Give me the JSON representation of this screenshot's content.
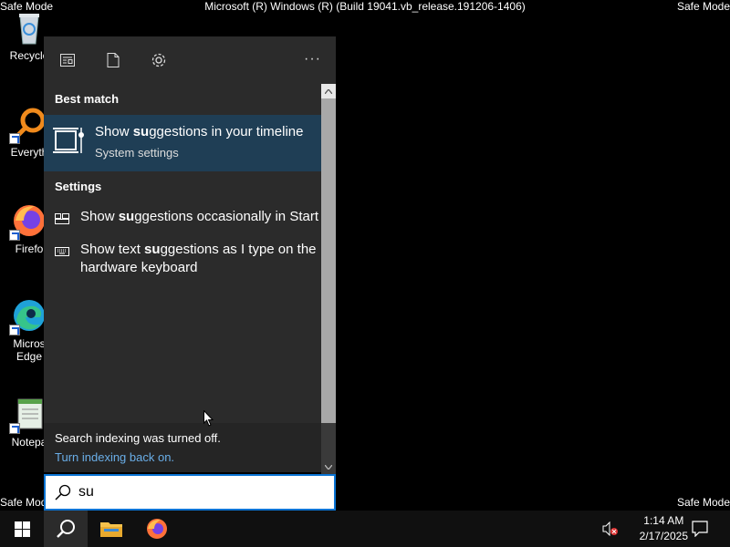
{
  "corners": {
    "top_left": "Safe Mode",
    "top_right": "Safe Mode",
    "bottom_left": "Safe Mode",
    "bottom_right": "Safe Mode",
    "build": "Microsoft (R) Windows (R) (Build 19041.vb_release.191206-1406)"
  },
  "desktop_icons": [
    {
      "label": "Recycle",
      "icon": "recycle-bin-icon"
    },
    {
      "label": "Everyth",
      "icon": "everything-search-icon"
    },
    {
      "label": "Firefo",
      "icon": "firefox-icon"
    },
    {
      "label": "Micros Edge",
      "label_line1": "Micros",
      "label_line2": "Edge",
      "icon": "edge-icon"
    },
    {
      "label": "Notepa",
      "icon": "notepad-icon"
    }
  ],
  "panel": {
    "top_icons": [
      "news-feed-icon",
      "document-icon",
      "gear-icon"
    ],
    "more": "···",
    "best_match_heading": "Best match",
    "best_match": {
      "title_pre": "Show ",
      "title_bold": "su",
      "title_post": "ggestions in your timeline",
      "subtitle": "System settings",
      "icon": "timeline-icon"
    },
    "settings_heading": "Settings",
    "settings_items": [
      {
        "pre": "Show ",
        "bold": "su",
        "post": "ggestions occasionally in Start",
        "icon": "start-layout-icon"
      },
      {
        "pre": "Show text ",
        "bold": "su",
        "post": "ggestions as I type on the",
        "line2": "hardware keyboard",
        "icon": "keyboard-icon"
      }
    ],
    "indexing_note": "Search indexing was turned off.",
    "indexing_link": "Turn indexing back on."
  },
  "search": {
    "value": "su"
  },
  "taskbar": {
    "time": "1:14 AM",
    "date": "2/17/2025"
  },
  "colors": {
    "accent": "#0a74d4",
    "highlight": "#1f3e55",
    "panel_bg": "#2b2b2b",
    "link": "#6aaee8"
  }
}
